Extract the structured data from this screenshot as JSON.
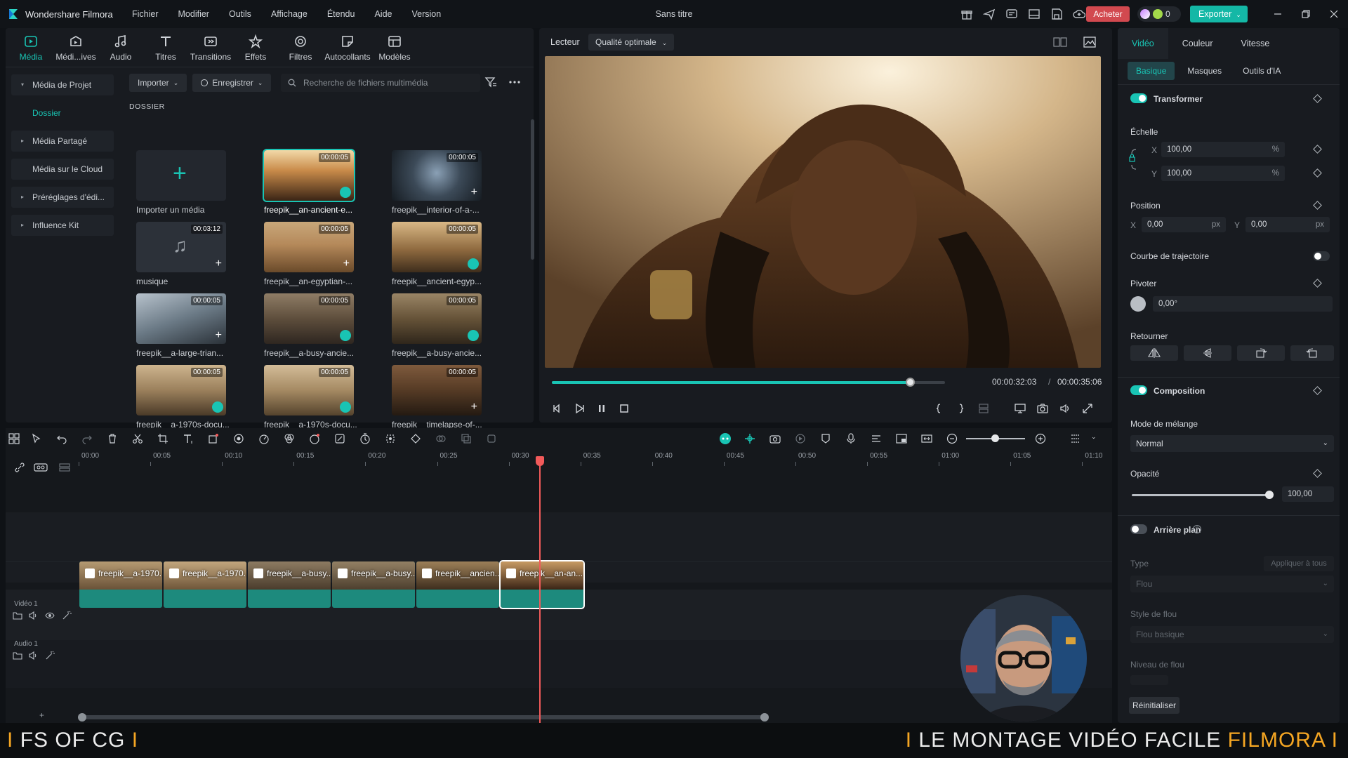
{
  "app": {
    "name": "Wondershare Filmora",
    "doc_title": "Sans titre",
    "buy_label": "Acheter",
    "credits": "0",
    "export_label": "Exporter"
  },
  "menu": [
    "Fichier",
    "Modifier",
    "Outils",
    "Affichage",
    "Étendu",
    "Aide",
    "Version"
  ],
  "media_tabs": [
    {
      "label": "Média",
      "icon": "media-icon"
    },
    {
      "label": "Médi...ives",
      "icon": "stock-media-icon"
    },
    {
      "label": "Audio",
      "icon": "audio-icon"
    },
    {
      "label": "Titres",
      "icon": "titles-icon"
    },
    {
      "label": "Transitions",
      "icon": "transitions-icon"
    },
    {
      "label": "Effets",
      "icon": "effects-icon"
    },
    {
      "label": "Filtres",
      "icon": "filters-icon"
    },
    {
      "label": "Autocollants",
      "icon": "stickers-icon"
    },
    {
      "label": "Modèles",
      "icon": "templates-icon"
    }
  ],
  "sidebar": [
    {
      "label": "Média de Projet",
      "caret": "▾"
    },
    {
      "label": "Dossier",
      "caret": ""
    },
    {
      "label": "Média Partagé",
      "caret": "▸"
    },
    {
      "label": "Média sur le Cloud",
      "caret": ""
    },
    {
      "label": "Préréglages d'édi...",
      "caret": "▸"
    },
    {
      "label": "Influence Kit",
      "caret": "▸"
    }
  ],
  "media_toolbar": {
    "import_label": "Importer",
    "record_label": "Enregistrer",
    "search_placeholder": "Recherche de fichiers multimédia"
  },
  "folder_label": "DOSSIER",
  "media_items": [
    {
      "name": "Importer un média",
      "duration": ""
    },
    {
      "name": "freepik__an-ancient-e...",
      "duration": "00:00:05"
    },
    {
      "name": "freepik__interior-of-a-...",
      "duration": "00:00:05"
    },
    {
      "name": "musique",
      "duration": "00:03:12"
    },
    {
      "name": "freepik__an-egyptian-...",
      "duration": "00:00:05"
    },
    {
      "name": "freepik__ancient-egyp...",
      "duration": "00:00:05"
    },
    {
      "name": "freepik__a-large-trian...",
      "duration": "00:00:05"
    },
    {
      "name": "freepik__a-busy-ancie...",
      "duration": "00:00:05"
    },
    {
      "name": "freepik__a-busy-ancie...",
      "duration": "00:00:05"
    },
    {
      "name": "freepik__a-1970s-docu...",
      "duration": "00:00:05"
    },
    {
      "name": "freepik__a-1970s-docu...",
      "duration": "00:00:05"
    },
    {
      "name": "freepik__timelapse-of-...",
      "duration": "00:00:05"
    }
  ],
  "player": {
    "label": "Lecteur",
    "quality": "Qualité optimale",
    "current": "00:00:32:03",
    "sep": "/",
    "total": "00:00:35:06",
    "progress": 0.91
  },
  "props": {
    "tabs": [
      "Vidéo",
      "Couleur",
      "Vitesse"
    ],
    "subtabs": [
      "Basique",
      "Masques",
      "Outils d'IA"
    ],
    "transform": "Transformer",
    "scale": "Échelle",
    "scale_x": "100,00",
    "scale_y": "100,00",
    "pct": "%",
    "position": "Position",
    "pos_x": "0,00",
    "pos_y": "0,00",
    "px": "px",
    "axis_x": "X",
    "axis_y": "Y",
    "path_curve": "Courbe de trajectoire",
    "rotate": "Pivoter",
    "rotate_val": "0,00°",
    "flip": "Retourner",
    "composition": "Composition",
    "blend_mode": "Mode de mélange",
    "blend_val": "Normal",
    "opacity": "Opacité",
    "opacity_val": "100,00",
    "background": "Arrière plan",
    "type": "Type",
    "apply_all": "Appliquer à tous",
    "type_val": "Flou",
    "blur_style": "Style de flou",
    "blur_style_val": "Flou basique",
    "blur_level": "Niveau de flou",
    "reset": "Réinitialiser"
  },
  "timeline": {
    "ticks": [
      "00:00",
      "00:05",
      "00:10",
      "00:15",
      "00:20",
      "00:25",
      "00:30",
      "00:35",
      "00:40",
      "00:45",
      "00:50",
      "00:55",
      "01:00",
      "01:05",
      "01:10"
    ],
    "video_track": "Vidéo 1",
    "audio_track": "Audio 1",
    "clips": [
      "freepik__a-1970...",
      "freepik__a-1970...",
      "freepik__a-busy...",
      "freepik__a-busy...",
      "freepik__ancien...",
      "freepik__an-an..."
    ]
  },
  "banner": {
    "left": "FS OF CG",
    "right_prefix": "LE MONTAGE VIDÉO FACILE",
    "right_accent": "FILMORA",
    "bar": "I"
  },
  "colors": {
    "accent": "#19c4b4",
    "buy": "#d2494f",
    "playhead": "#f25a5a",
    "banner_accent": "#f5a623"
  }
}
